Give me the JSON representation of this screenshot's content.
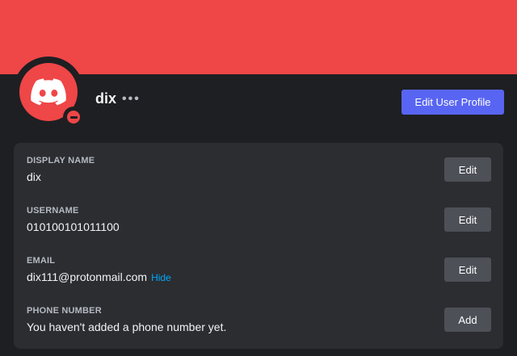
{
  "profile": {
    "display_name": "dix",
    "more_label": "•••",
    "edit_profile_label": "Edit User Profile",
    "status": "do-not-disturb"
  },
  "fields": [
    {
      "label": "DISPLAY NAME",
      "value": "dix",
      "button": "Edit"
    },
    {
      "label": "USERNAME",
      "value": "010100101011100",
      "button": "Edit"
    },
    {
      "label": "EMAIL",
      "value": "dix111@protonmail.com",
      "link": "Hide",
      "button": "Edit"
    },
    {
      "label": "PHONE NUMBER",
      "value": "You haven't added a phone number yet.",
      "button": "Add"
    }
  ],
  "colors": {
    "banner": "#ef4647",
    "accent": "#5865f2",
    "link": "#00a8fc"
  },
  "icons": {
    "avatar": "discord-logo-icon",
    "status": "do-not-disturb-icon",
    "more": "more-options-icon"
  }
}
